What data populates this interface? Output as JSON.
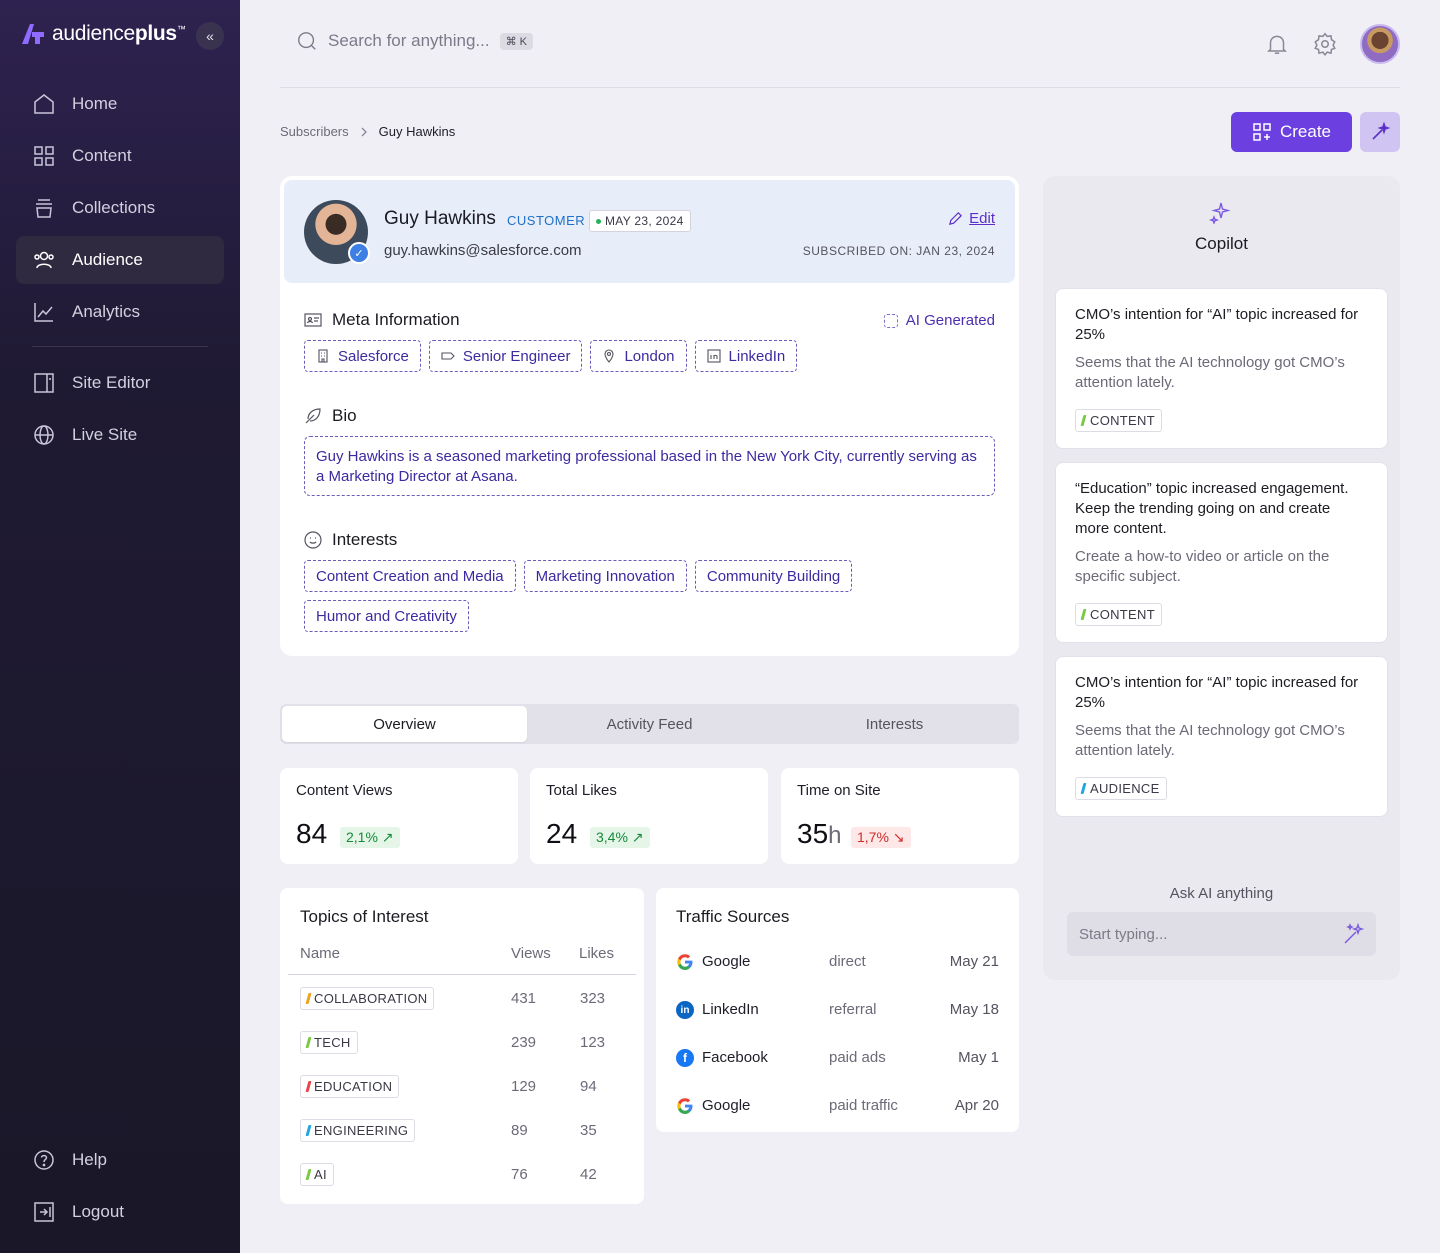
{
  "brand": {
    "name_light": "audience",
    "name_bold": "plus",
    "trademark": "™",
    "accent": "#6b3fe0"
  },
  "sidebar": {
    "collapse_glyph": "«",
    "items": [
      {
        "label": "Home",
        "icon": "home-icon"
      },
      {
        "label": "Content",
        "icon": "grid-icon"
      },
      {
        "label": "Collections",
        "icon": "collections-icon"
      },
      {
        "label": "Audience",
        "icon": "users-icon",
        "active": true
      },
      {
        "label": "Analytics",
        "icon": "chart-line-icon"
      }
    ],
    "items2": [
      {
        "label": "Site Editor",
        "icon": "layout-icon"
      },
      {
        "label": "Live Site",
        "icon": "globe-icon"
      }
    ],
    "bottom": [
      {
        "label": "Help",
        "icon": "help-icon"
      },
      {
        "label": "Logout",
        "icon": "logout-icon"
      }
    ]
  },
  "topbar": {
    "search_placeholder": "Search for anything...",
    "shortcut": "⌘ K"
  },
  "breadcrumb": {
    "parent": "Subscribers",
    "current": "Guy Hawkins"
  },
  "actions": {
    "create_label": "Create"
  },
  "profile": {
    "name": "Guy Hawkins",
    "type": "CUSTOMER",
    "date": "MAY 23, 2024",
    "email": "guy.hawkins@salesforce.com",
    "edit_label": "Edit",
    "subscribed": "SUBSCRIBED ON: JAN 23, 2024",
    "meta_title": "Meta Information",
    "ai_generated": "AI Generated",
    "meta": {
      "company": "Salesforce",
      "role": "Senior Engineer",
      "location": "London",
      "social": "LinkedIn"
    },
    "bio_title": "Bio",
    "bio": "Guy Hawkins is a seasoned marketing professional based in the New York City, currently serving as a Marketing Director at Asana.",
    "interests_title": "Interests",
    "interests": [
      "Content Creation and Media",
      "Marketing Innovation",
      "Community Building",
      "Humor and Creativity"
    ]
  },
  "tabs": [
    "Overview",
    "Activity Feed",
    "Interests"
  ],
  "stats": [
    {
      "label": "Content Views",
      "value": "84",
      "unit": "",
      "delta": "2,1% ↗",
      "trend": "up"
    },
    {
      "label": "Total Likes",
      "value": "24",
      "unit": "",
      "delta": "3,4% ↗",
      "trend": "up"
    },
    {
      "label": "Time on Site",
      "value": "35",
      "unit": "h",
      "delta": "1,7% ↘",
      "trend": "down"
    }
  ],
  "topics": {
    "title": "Topics of Interest",
    "headers": {
      "name": "Name",
      "views": "Views",
      "likes": "Likes"
    },
    "rows": [
      {
        "tag": "COLLABORATION",
        "color": "#f0a21a",
        "views": "431",
        "likes": "323"
      },
      {
        "tag": "TECH",
        "color": "#7ac943",
        "views": "239",
        "likes": "123"
      },
      {
        "tag": "EDUCATION",
        "color": "#e8424a",
        "views": "129",
        "likes": "94"
      },
      {
        "tag": "ENGINEERING",
        "color": "#1fa7e0",
        "views": "89",
        "likes": "35"
      },
      {
        "tag": "AI",
        "color": "#7ac943",
        "views": "76",
        "likes": "42"
      }
    ]
  },
  "traffic": {
    "title": "Traffic Sources",
    "rows": [
      {
        "name": "Google",
        "type": "direct",
        "date": "May 21",
        "icon": "google-icon"
      },
      {
        "name": "LinkedIn",
        "type": "referral",
        "date": "May 18",
        "icon": "linkedin-icon"
      },
      {
        "name": "Facebook",
        "type": "paid ads",
        "date": "May 1",
        "icon": "facebook-icon"
      },
      {
        "name": "Google",
        "type": "paid traffic",
        "date": "Apr 20",
        "icon": "google-icon"
      }
    ]
  },
  "copilot": {
    "title": "Copilot",
    "tips": [
      {
        "title": "CMO’s intention for “AI” topic increased for 25%",
        "body": "Seems that the AI technology got CMO’s attention lately.",
        "tag": "CONTENT",
        "color": "#7ac943"
      },
      {
        "title": "“Education” topic increased engagement. Keep the trending going on and create more content.",
        "body": "Create a how-to video or article on the specific subject.",
        "tag": "CONTENT",
        "color": "#7ac943"
      },
      {
        "title": "CMO’s intention for “AI” topic increased for 25%",
        "body": "Seems that the AI technology got CMO’s attention lately.",
        "tag": "AUDIENCE",
        "color": "#1fa7e0"
      }
    ],
    "ask_label": "Ask AI anything",
    "ask_placeholder": "Start typing..."
  }
}
